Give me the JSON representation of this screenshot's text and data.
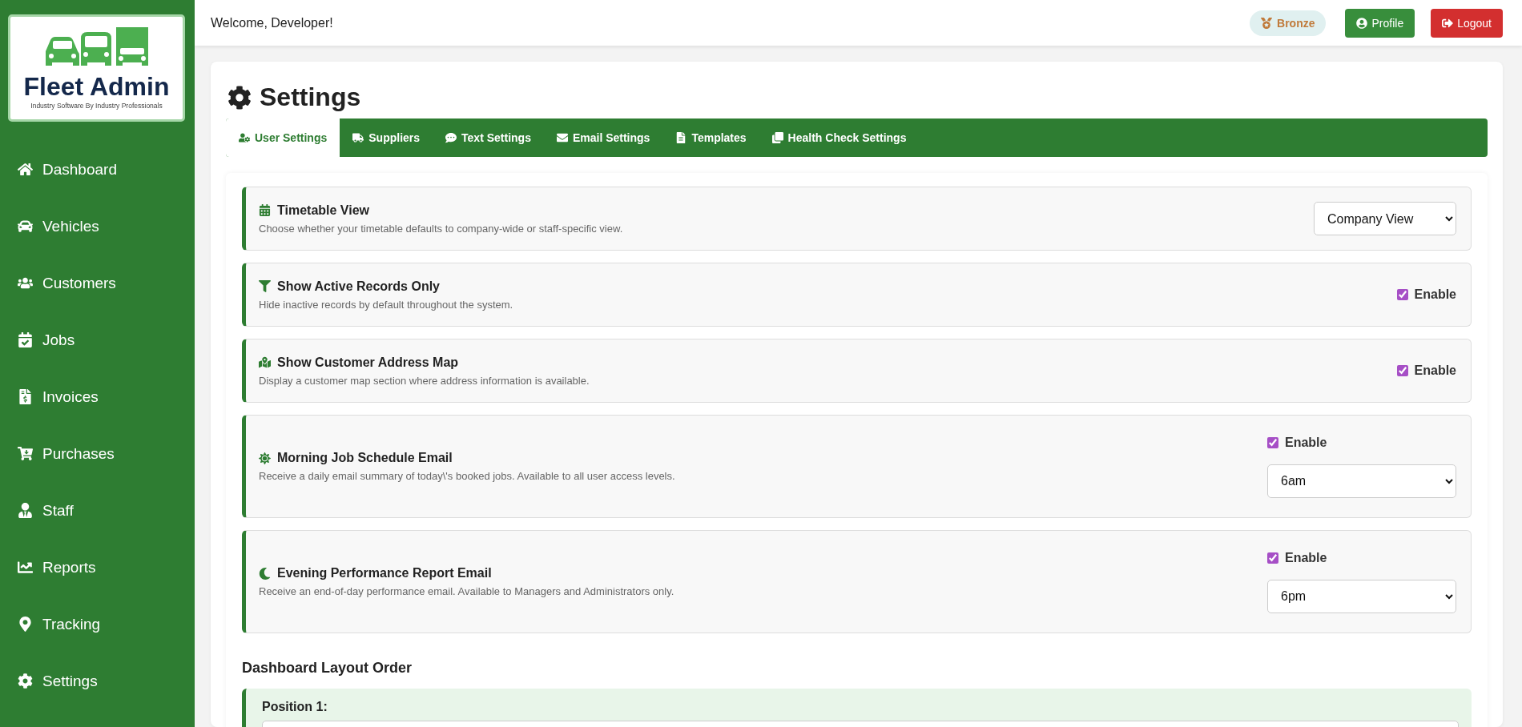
{
  "logo": {
    "title": "Fleet Admin",
    "tagline": "Industry Software By Industry Professionals"
  },
  "sidebar": {
    "items": [
      {
        "label": "Dashboard"
      },
      {
        "label": "Vehicles"
      },
      {
        "label": "Customers"
      },
      {
        "label": "Jobs"
      },
      {
        "label": "Invoices"
      },
      {
        "label": "Purchases"
      },
      {
        "label": "Staff"
      },
      {
        "label": "Reports"
      },
      {
        "label": "Tracking"
      },
      {
        "label": "Settings"
      }
    ]
  },
  "header": {
    "welcome": "Welcome, Developer!",
    "badge": "Bronze",
    "buttons": [
      {
        "label": "Profile",
        "kind": "primary"
      },
      {
        "label": "Logout",
        "kind": "danger"
      }
    ]
  },
  "page": {
    "title": "Settings"
  },
  "tabs": [
    {
      "label": "User Settings",
      "selected": true
    },
    {
      "label": "Suppliers",
      "selected": false
    },
    {
      "label": "Text Settings",
      "selected": false
    },
    {
      "label": "Email Settings",
      "selected": false
    },
    {
      "label": "Templates",
      "selected": false
    },
    {
      "label": "Health Check Settings",
      "selected": false
    }
  ],
  "settings": [
    {
      "kind": "select",
      "title": "Timetable View",
      "description": "Choose whether your timetable defaults to company-wide or staff-specific view.",
      "value": "Company View"
    },
    {
      "kind": "checkbox",
      "title": "Show Active Records Only",
      "description": "Hide inactive records by default throughout the system.",
      "checkbox": {
        "label": "Enable",
        "checked": true
      }
    },
    {
      "kind": "checkbox",
      "title": "Show Customer Address Map",
      "description": "Display a customer map section where address information is available.",
      "checkbox": {
        "label": "Enable",
        "checked": true
      }
    },
    {
      "kind": "checkbox_select",
      "title": "Morning Job Schedule Email",
      "description": "Receive a daily email summary of today\\'s booked jobs. Available to all user access levels.",
      "checkbox": {
        "label": "Enable",
        "checked": true
      },
      "value": "6am"
    },
    {
      "kind": "checkbox_select",
      "title": "Evening Performance Report Email",
      "description": "Receive an end-of-day performance email. Available to Managers and Administrators only.",
      "checkbox": {
        "label": "Enable",
        "checked": true
      },
      "value": "6pm"
    }
  ],
  "layout_order": {
    "title": "Dashboard Layout Order",
    "positions": [
      {
        "label": "Position 1:"
      }
    ]
  }
}
